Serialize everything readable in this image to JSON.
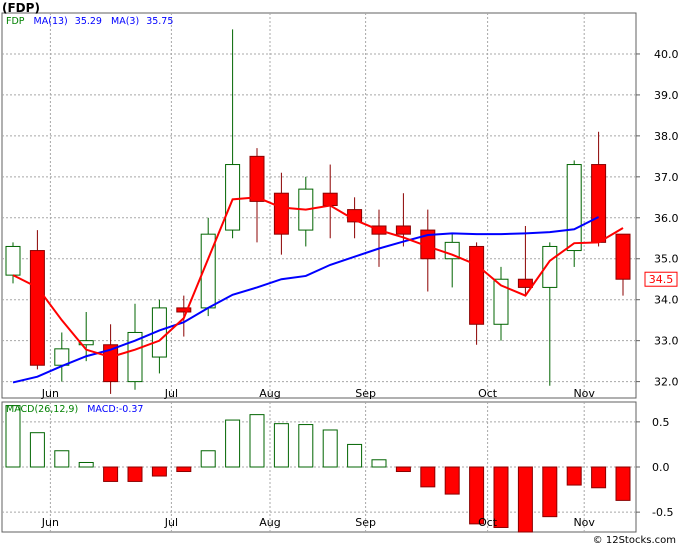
{
  "header": {
    "title": "(FDP)"
  },
  "footer": {
    "watermark": "© 12Stocks.com"
  },
  "colors": {
    "up_body": "#ffffff",
    "up_border": "#006400",
    "down_body": "#ff0000",
    "down_border": "#8b0000",
    "ma13": "#0000ff",
    "ma3": "#ff0000",
    "grid": "#a8a8a8",
    "label_box": "#ff0000"
  },
  "chart_data": [
    {
      "type": "candlestick",
      "legend": [
        {
          "label": "FDP",
          "color": "#008000"
        },
        {
          "label": "MA(13)",
          "color": "#0000ff"
        },
        {
          "label": "35.29",
          "color": "#0000ff"
        },
        {
          "label": "MA(3)",
          "color": "#0000ff"
        },
        {
          "label": "35.75",
          "color": "#0000ff"
        }
      ],
      "last_price_label": "34.5",
      "ylim": [
        31.6,
        41.0
      ],
      "yticks": [
        32.0,
        33.0,
        34.0,
        35.0,
        36.0,
        37.0,
        38.0,
        39.0,
        40.0
      ],
      "ytick_labels": [
        "32.0",
        "33.0",
        "34.0",
        "35.0",
        "36.0",
        "37.0",
        "38.0",
        "39.0",
        "40.0"
      ],
      "grid": true,
      "month_labels": [
        {
          "label": "Jun",
          "index": 1
        },
        {
          "label": "Jul",
          "index": 6
        },
        {
          "label": "Aug",
          "index": 10
        },
        {
          "label": "Sep",
          "index": 14
        },
        {
          "label": "Oct",
          "index": 19
        },
        {
          "label": "Nov",
          "index": 23
        }
      ],
      "candles": [
        {
          "open": 34.6,
          "high": 35.4,
          "low": 34.4,
          "close": 35.3
        },
        {
          "open": 35.2,
          "high": 35.7,
          "low": 32.3,
          "close": 32.4
        },
        {
          "open": 32.4,
          "high": 33.2,
          "low": 32.0,
          "close": 32.8
        },
        {
          "open": 32.9,
          "high": 33.7,
          "low": 32.5,
          "close": 33.0
        },
        {
          "open": 32.9,
          "high": 33.4,
          "low": 31.7,
          "close": 32.0
        },
        {
          "open": 32.0,
          "high": 33.9,
          "low": 31.8,
          "close": 33.2
        },
        {
          "open": 32.6,
          "high": 34.0,
          "low": 32.2,
          "close": 33.8
        },
        {
          "open": 33.8,
          "high": 34.1,
          "low": 33.1,
          "close": 33.7
        },
        {
          "open": 33.8,
          "high": 36.0,
          "low": 33.6,
          "close": 35.6
        },
        {
          "open": 35.7,
          "high": 40.6,
          "low": 35.5,
          "close": 37.3
        },
        {
          "open": 37.5,
          "high": 37.7,
          "low": 35.4,
          "close": 36.4
        },
        {
          "open": 36.6,
          "high": 37.1,
          "low": 35.1,
          "close": 35.6
        },
        {
          "open": 35.7,
          "high": 37.0,
          "low": 35.3,
          "close": 36.7
        },
        {
          "open": 36.6,
          "high": 37.3,
          "low": 35.5,
          "close": 36.3
        },
        {
          "open": 36.2,
          "high": 36.5,
          "low": 35.5,
          "close": 35.9
        },
        {
          "open": 35.8,
          "high": 36.2,
          "low": 34.8,
          "close": 35.6
        },
        {
          "open": 35.8,
          "high": 36.6,
          "low": 35.3,
          "close": 35.6
        },
        {
          "open": 35.7,
          "high": 36.2,
          "low": 34.2,
          "close": 35.0
        },
        {
          "open": 35.0,
          "high": 35.6,
          "low": 34.3,
          "close": 35.4
        },
        {
          "open": 35.3,
          "high": 35.4,
          "low": 32.9,
          "close": 33.4
        },
        {
          "open": 33.4,
          "high": 34.8,
          "low": 33.0,
          "close": 34.5
        },
        {
          "open": 34.5,
          "high": 35.8,
          "low": 34.1,
          "close": 34.3
        },
        {
          "open": 34.3,
          "high": 35.4,
          "low": 31.9,
          "close": 35.3
        },
        {
          "open": 35.2,
          "high": 37.4,
          "low": 34.8,
          "close": 37.3
        },
        {
          "open": 37.3,
          "high": 38.1,
          "low": 35.3,
          "close": 35.4
        },
        {
          "open": 35.6,
          "high": 35.6,
          "low": 34.1,
          "close": 34.5
        }
      ],
      "series": [
        {
          "name": "MA(13)",
          "start_index": 0,
          "values": [
            31.98,
            32.12,
            32.38,
            32.62,
            32.78,
            33.0,
            33.25,
            33.45,
            33.8,
            34.12,
            34.3,
            34.5,
            34.58,
            34.85,
            35.05,
            35.25,
            35.42,
            35.58,
            35.62,
            35.6,
            35.6,
            35.62,
            35.65,
            35.72,
            36.02
          ]
        },
        {
          "name": "MA(3)",
          "start_index": 0,
          "values": [
            34.6,
            34.3,
            33.5,
            32.78,
            32.6,
            32.78,
            33.0,
            33.55,
            35.0,
            36.45,
            36.5,
            36.25,
            36.2,
            36.3,
            35.95,
            35.7,
            35.52,
            35.3,
            35.1,
            34.85,
            34.35,
            34.1,
            34.95,
            35.38,
            35.4,
            35.75
          ]
        }
      ]
    },
    {
      "type": "bar",
      "title": "MACD(26,12,9)",
      "legend": [
        {
          "label": "MACD(26,12,9)",
          "color": "#008000"
        },
        {
          "label": "MACD:-0.37",
          "color": "#0000ff"
        }
      ],
      "ylim": [
        -0.72,
        0.72
      ],
      "yticks": [
        -0.5,
        0.0,
        0.5
      ],
      "ytick_labels": [
        "-0.5",
        "0.0",
        "0.5"
      ],
      "grid": true,
      "values": [
        0.68,
        0.38,
        0.18,
        0.05,
        -0.16,
        -0.16,
        -0.1,
        -0.05,
        0.18,
        0.52,
        0.58,
        0.48,
        0.47,
        0.41,
        0.25,
        0.08,
        -0.05,
        -0.22,
        -0.3,
        -0.63,
        -0.67,
        -0.72,
        -0.55,
        -0.2,
        -0.23,
        -0.37
      ]
    }
  ]
}
